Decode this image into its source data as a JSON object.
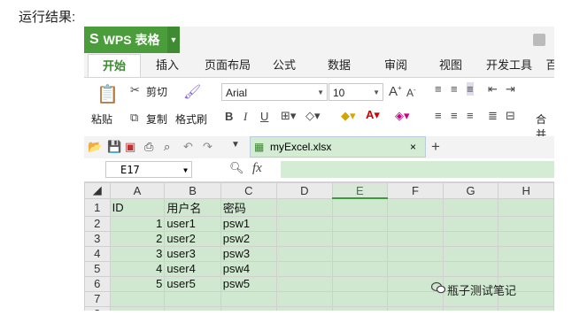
{
  "caption": "运行结果:",
  "app": {
    "logo": "WPS 表格",
    "logo_glyph": "S"
  },
  "tabs": [
    "开始",
    "插入",
    "页面布局",
    "公式",
    "数据",
    "审阅",
    "视图",
    "开发工具",
    "百"
  ],
  "ribbon": {
    "paste": "粘贴",
    "cut": "剪切",
    "copy": "复制",
    "format_painter": "格式刷",
    "font": "Arial",
    "size": "10",
    "bold": "B",
    "italic": "I",
    "underline": "U",
    "merge": "合并"
  },
  "quick": {
    "file_name": "myExcel.xlsx",
    "close": "×",
    "new_tab": "+"
  },
  "formula_bar": {
    "cell_ref": "E17",
    "fx": "fx"
  },
  "sheet": {
    "columns": [
      "A",
      "B",
      "C",
      "D",
      "E",
      "F",
      "G",
      "H"
    ],
    "selected_col": "E",
    "rows": [
      {
        "n": "1",
        "cells": [
          "ID",
          "用户名",
          "密码",
          "",
          "",
          "",
          "",
          ""
        ]
      },
      {
        "n": "2",
        "cells": [
          "1",
          "user1",
          "psw1",
          "",
          "",
          "",
          "",
          ""
        ]
      },
      {
        "n": "3",
        "cells": [
          "2",
          "user2",
          "psw2",
          "",
          "",
          "",
          "",
          ""
        ]
      },
      {
        "n": "4",
        "cells": [
          "3",
          "user3",
          "psw3",
          "",
          "",
          "",
          "",
          ""
        ]
      },
      {
        "n": "5",
        "cells": [
          "4",
          "user4",
          "psw4",
          "",
          "",
          "",
          "",
          ""
        ]
      },
      {
        "n": "6",
        "cells": [
          "5",
          "user5",
          "psw5",
          "",
          "",
          "",
          "",
          ""
        ]
      },
      {
        "n": "7",
        "cells": [
          "",
          "",
          "",
          "",
          "",
          "",
          "",
          ""
        ]
      },
      {
        "n": "8",
        "cells": [
          "",
          "",
          "",
          "",
          "",
          "",
          "",
          ""
        ]
      }
    ]
  },
  "watermark": "瓶子测试笔记",
  "colors": {
    "brand": "#4a9d3a",
    "cell": "#cfe8cf",
    "accent": "#3a8a2f"
  }
}
